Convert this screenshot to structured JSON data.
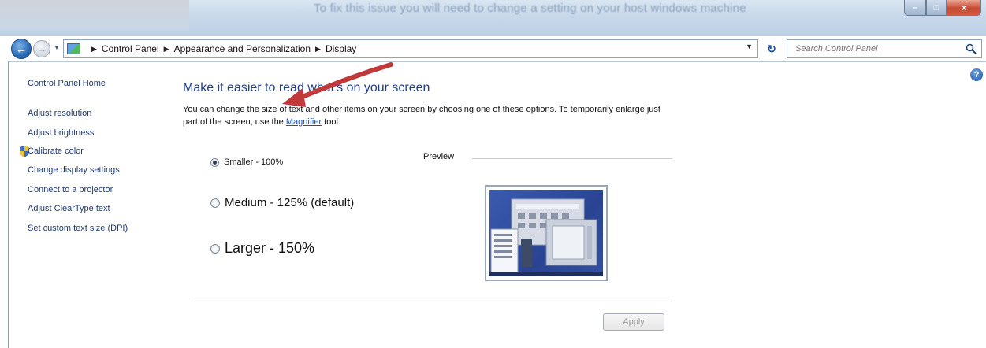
{
  "window": {
    "overlay_text": "To fix this issue you will need to change a setting on your host windows machine",
    "controls": {
      "minimize": "–",
      "maximize": "□",
      "close": "x"
    }
  },
  "address_bar": {
    "breadcrumbs": [
      "Control Panel",
      "Appearance and Personalization",
      "Display"
    ],
    "search_placeholder": "Search Control Panel"
  },
  "sidebar": {
    "home": "Control Panel Home",
    "links": [
      "Adjust resolution",
      "Adjust brightness",
      "Calibrate color",
      "Change display settings",
      "Connect to a projector",
      "Adjust ClearType text",
      "Set custom text size (DPI)"
    ]
  },
  "main": {
    "heading": "Make it easier to read what's on your screen",
    "description_before_link": "You can change the size of text and other items on your screen by choosing one of these options. To temporarily enlarge just part of the screen, use the ",
    "magnifier_link": "Magnifier",
    "description_after_link": " tool.",
    "options": [
      {
        "label": "Smaller - 100%",
        "selected": true
      },
      {
        "label": "Medium - 125% (default)",
        "selected": false
      },
      {
        "label": "Larger - 150%",
        "selected": false
      }
    ],
    "preview_label": "Preview",
    "apply_label": "Apply"
  },
  "colors": {
    "heading": "#1e3f8c",
    "link": "#1e3a6e",
    "annotation_arrow": "#c0393b"
  },
  "icons": [
    "back-arrow-icon",
    "forward-arrow-icon",
    "control-panel-icon",
    "refresh-icon",
    "search-icon",
    "help-icon",
    "shield-icon"
  ]
}
